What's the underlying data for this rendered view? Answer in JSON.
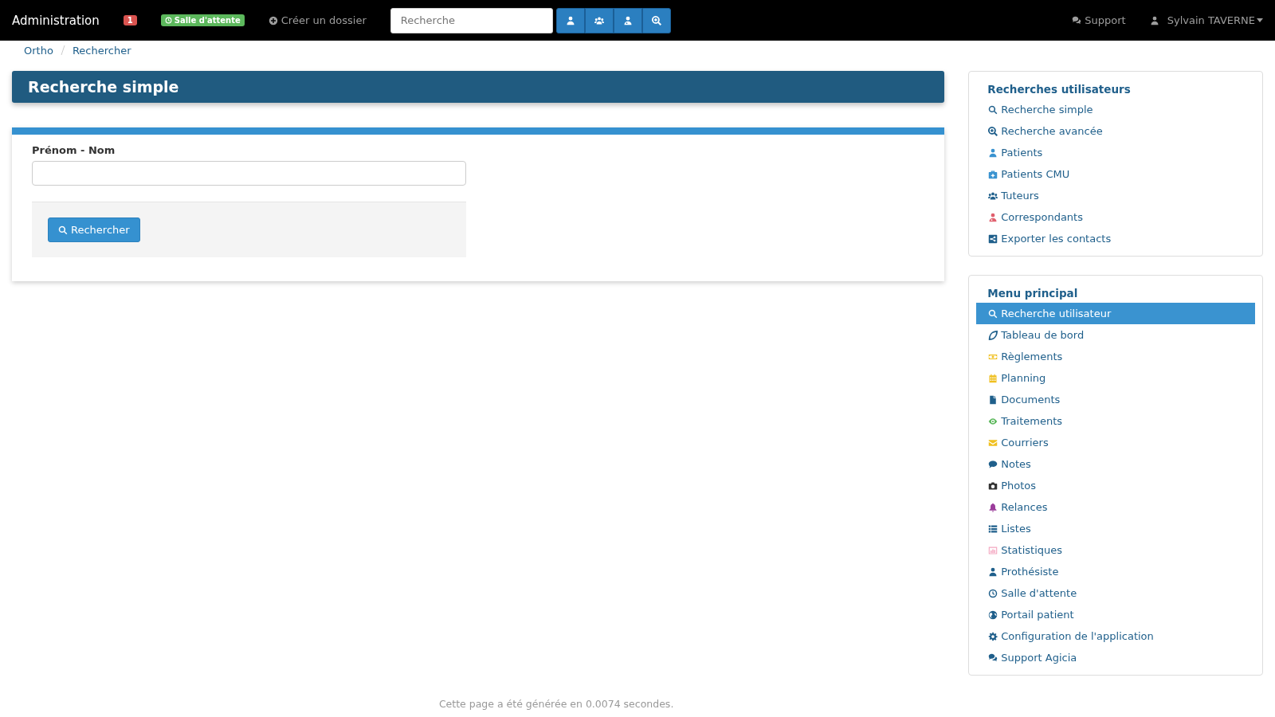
{
  "navbar": {
    "brand": "Administration",
    "notification_count": "1",
    "waiting_room_badge": "Salle d'attente",
    "create_link": "Créer un dossier",
    "search": {
      "placeholder": "Recherche"
    },
    "support_link": "Support",
    "user_menu": "Sylvain TAVERNE"
  },
  "breadcrumb": [
    "Ortho",
    "Rechercher"
  ],
  "page_title": "Recherche simple",
  "form": {
    "field_label": "Prénom - Nom",
    "submit": "Rechercher"
  },
  "sidebar": [
    {
      "title": "Recherches utilisateurs",
      "items": [
        {
          "label": "Recherche simple",
          "kind": "search",
          "color": "#1f5f8b",
          "selected": false
        },
        {
          "label": "Recherche avancée",
          "kind": "search-plus",
          "color": "#1f5f8b",
          "selected": false
        },
        {
          "label": "Patients",
          "kind": "user",
          "color": "#3a93d0",
          "selected": false
        },
        {
          "label": "Patients CMU",
          "kind": "medkit",
          "color": "#3a93d0",
          "selected": false
        },
        {
          "label": "Tuteurs",
          "kind": "users",
          "color": "#1f5f8b",
          "selected": false
        },
        {
          "label": "Correspondants",
          "kind": "user-md",
          "color": "#e0606e",
          "selected": false
        },
        {
          "label": "Exporter les contacts",
          "kind": "share",
          "color": "#1f5f8b",
          "selected": false
        }
      ]
    },
    {
      "title": "Menu principal",
      "items": [
        {
          "label": "Recherche utilisateur",
          "kind": "search",
          "color": "#ffffff",
          "selected": true
        },
        {
          "label": "Tableau de bord",
          "kind": "leaf",
          "color": "#1f5f8b",
          "selected": false
        },
        {
          "label": "Règlements",
          "kind": "money",
          "color": "#f0c020",
          "selected": false
        },
        {
          "label": "Planning",
          "kind": "calendar",
          "color": "#f0c020",
          "selected": false
        },
        {
          "label": "Documents",
          "kind": "file",
          "color": "#1f5f8b",
          "selected": false
        },
        {
          "label": "Traitements",
          "kind": "eye",
          "color": "#5cb85c",
          "selected": false
        },
        {
          "label": "Courriers",
          "kind": "envelope",
          "color": "#f0c020",
          "selected": false
        },
        {
          "label": "Notes",
          "kind": "comment",
          "color": "#1f5f8b",
          "selected": false
        },
        {
          "label": "Photos",
          "kind": "camera",
          "color": "#333333",
          "selected": false
        },
        {
          "label": "Relances",
          "kind": "bell",
          "color": "#9b3d9b",
          "selected": false
        },
        {
          "label": "Listes",
          "kind": "list",
          "color": "#1f5f8b",
          "selected": false
        },
        {
          "label": "Statistiques",
          "kind": "chart",
          "color": "#f4a6c0",
          "selected": false
        },
        {
          "label": "Prothésiste",
          "kind": "user",
          "color": "#1f5f8b",
          "selected": false
        },
        {
          "label": "Salle d'attente",
          "kind": "clock",
          "color": "#1f5f8b",
          "selected": false
        },
        {
          "label": "Portail patient",
          "kind": "globe",
          "color": "#1f5f8b",
          "selected": false
        },
        {
          "label": "Configuration de l'application",
          "kind": "cog",
          "color": "#1f5f8b",
          "selected": false
        },
        {
          "label": "Support Agicia",
          "kind": "comments",
          "color": "#1f5f8b",
          "selected": false
        }
      ]
    }
  ],
  "footer": "Cette page a été générée en 0.0074 secondes."
}
